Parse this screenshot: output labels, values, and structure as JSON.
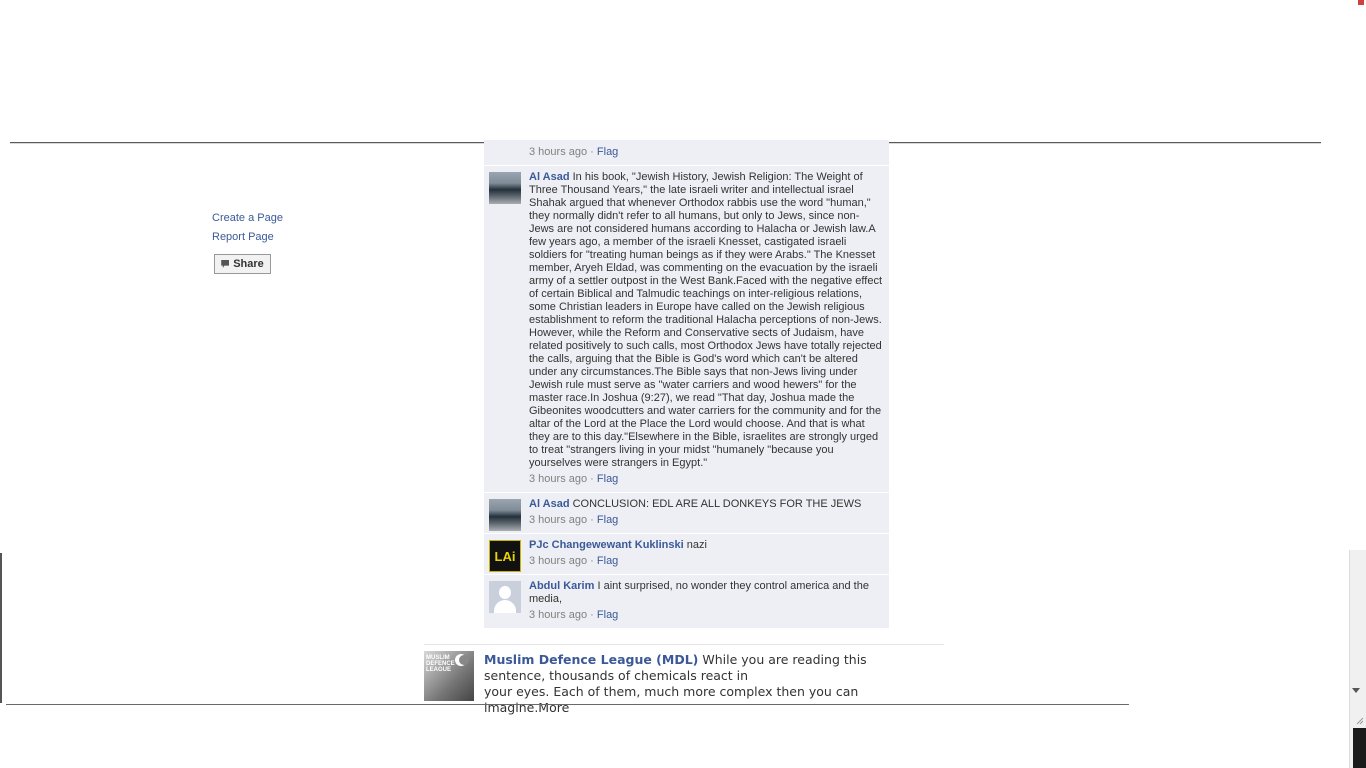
{
  "left_links": [
    "Create a Page",
    "Report Page"
  ],
  "share_label": "Share",
  "comments": [
    {
      "author": "",
      "text": "",
      "time": "3 hours ago",
      "flag": "Flag"
    },
    {
      "author": "Al Asad",
      "text": "In his book, \"Jewish History, Jewish Religion: The Weight of Three Thousand Years,\" the late israeli writer and intellectual israel Shahak argued that whenever Orthodox rabbis use the word \"human,\" they normally didn't refer to all humans, but only to Jews, since non-Jews are not considered humans according to Halacha or Jewish law.A few years ago, a member of the israeli Knesset, castigated israeli soldiers for \"treating human beings as if they were Arabs.\" The Knesset member, Aryeh Eldad, was commenting on the evacuation by the israeli army of a settler outpost in the West Bank.Faced with the negative effect of certain Biblical and Talmudic teachings on inter-religious relations, some Christian leaders in Europe have called on the Jewish religious establishment to reform the traditional Halacha perceptions of non-Jews. However, while the Reform and Conservative sects of Judaism, have related positively to such calls, most Orthodox Jews have totally rejected the calls, arguing that the Bible is God's word which can't be altered under any circumstances.The Bible says that non-Jews living under Jewish rule must serve as \"water carriers and wood hewers\" for the master race.In Joshua (9:27), we read \"That day, Joshua made the Gibeonites woodcutters and water carriers for the community and for the altar of the Lord at the Place the Lord would choose. And that is what they are to this day.\"Elsewhere in the Bible, israelites are strongly urged to treat \"strangers living in your midst \"humanely \"because you yourselves were strangers in Egypt.\"",
      "time": "3 hours ago",
      "flag": "Flag"
    },
    {
      "author": "Al Asad",
      "text": "CONCLUSION: EDL ARE ALL DONKEYS FOR THE JEWS",
      "time": "3 hours ago",
      "flag": "Flag"
    },
    {
      "author": "PJc Changewewant Kuklinski",
      "text": "nazi",
      "time": "3 hours ago",
      "flag": "Flag"
    },
    {
      "author": "Abdul Karim",
      "text": "I aint surprised, no wonder they control america and the media,",
      "time": "3 hours ago",
      "flag": "Flag"
    }
  ],
  "avatar_lai_text": "LAi",
  "post": {
    "author": "Muslim Defence League (MDL)",
    "text_line1": "While you are reading this sentence, thousands of chemicals react in",
    "text_line2": "your eyes. Each of them, much more complex then you can imagine.More",
    "pic_text": "MUSLIM DEFENCE LEAGUE"
  },
  "separator": "·",
  "colors": {
    "link": "#3b5998",
    "comment_bg": "#edeff4"
  }
}
